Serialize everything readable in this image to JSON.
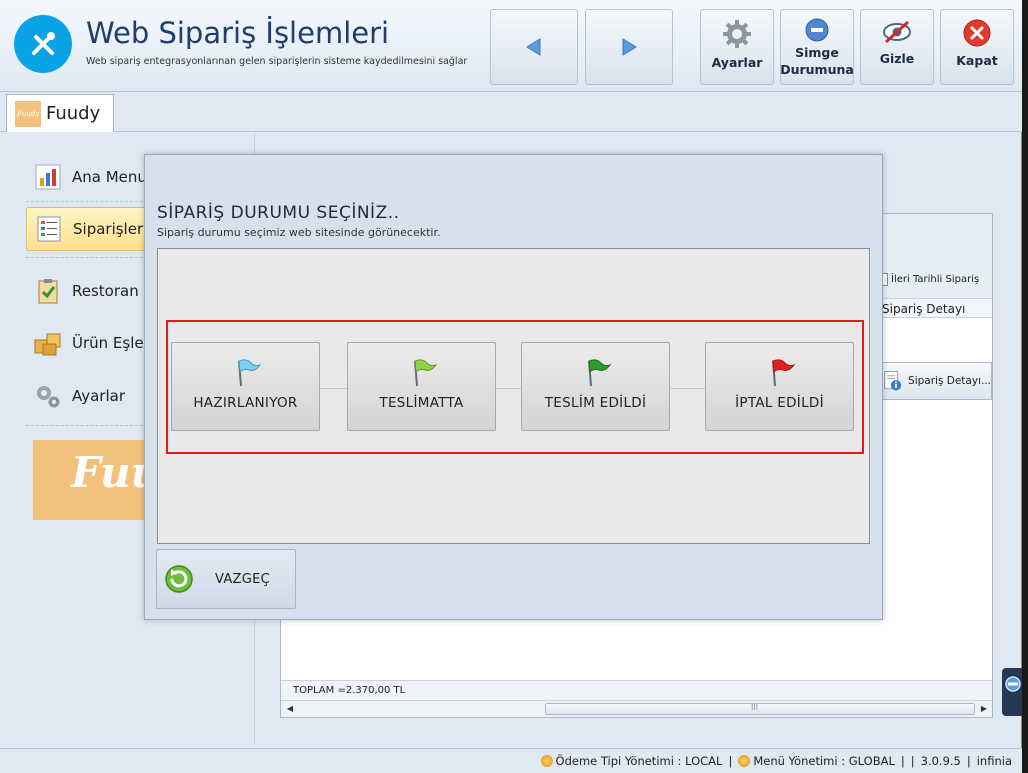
{
  "window": {
    "title": "Web Sipariş İşlemleri",
    "subtitle": "Web sipariş entegrasyonlarınan gelen siparişlerin sisteme kaydedilmesini sağlar"
  },
  "toolbar": {
    "back_icon": "arrow-left-icon",
    "forward_icon": "arrow-right-icon",
    "settings_label": "Ayarlar",
    "minimize_label_line1": "Simge",
    "minimize_label_line2": "Durumuna",
    "hide_label": "Gizle",
    "close_label": "Kapat"
  },
  "tab": {
    "label": "Fuudy",
    "logo_text": "Fuudy"
  },
  "sidebar": {
    "items": [
      {
        "label": "Ana Menu",
        "icon": "bar-chart-icon"
      },
      {
        "label": "Siparişler",
        "icon": "list-icon",
        "active": true
      },
      {
        "label": "Restoran İş",
        "icon": "clipboard-check-icon"
      },
      {
        "label": "Ürün Eşleş",
        "icon": "boxes-icon"
      },
      {
        "label": "Ayarlar",
        "icon": "gears-icon"
      }
    ],
    "banner_text": "Fuudy"
  },
  "main": {
    "future_order_checkbox": "İleri Tarihli Sipariş",
    "column_header": "Sipariş Detayı",
    "detail_button": "Sipariş Detayı...",
    "total": "TOPLAM =2.370,00 TL",
    "scroll_grip": "III"
  },
  "dialog": {
    "title": "SİPARİŞ DURUMU SEÇİNİZ..",
    "subtitle": "Sipariş durumu seçimiz web sitesinde görünecektir.",
    "statuses": [
      {
        "label": "HAZIRLANIYOR",
        "flag_color": "#7fd0f0"
      },
      {
        "label": "TESLİMATTA",
        "flag_color": "#8fd14a"
      },
      {
        "label": "TESLİM EDİLDİ",
        "flag_color": "#2f9a2f"
      },
      {
        "label": "İPTAL EDİLDİ",
        "flag_color": "#e02020"
      }
    ],
    "cancel_label": "VAZGEÇ"
  },
  "statusbar": {
    "payment_type": "Ödeme Tipi Yönetimi : LOCAL",
    "menu_mgmt": "Menü Yönetimi : GLOBAL",
    "version": "3.0.9.5",
    "vendor": "infinia"
  },
  "colors": {
    "accent_blue": "#0aa3e6",
    "highlight_red": "#e31b1b",
    "brand_orange": "#f2c27c"
  }
}
